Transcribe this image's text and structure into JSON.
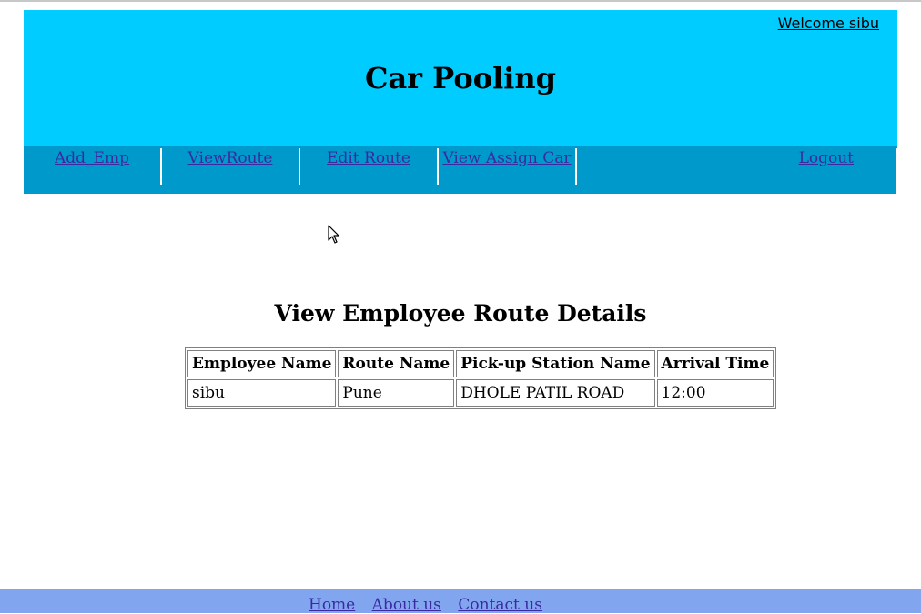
{
  "header": {
    "welcome": "Welcome sibu",
    "title": "Car Pooling",
    "background": "#00ccff"
  },
  "nav": {
    "items": [
      {
        "label": "Add_Emp"
      },
      {
        "label": "ViewRoute"
      },
      {
        "label": "Edit Route"
      },
      {
        "label": "View Assign Car"
      },
      {
        "label": "Logout"
      }
    ],
    "background": "#0099cc"
  },
  "main": {
    "title": "View Employee Route Details",
    "table": {
      "headers": [
        "Employee Name",
        "Route Name",
        "Pick-up Station Name",
        "Arrival Time"
      ],
      "rows": [
        [
          "sibu",
          "Pune",
          "DHOLE PATIL ROAD",
          "12:00"
        ]
      ]
    }
  },
  "footer": {
    "links": [
      "Home",
      "About us",
      "Contact us"
    ],
    "background": "#82a5f0"
  },
  "icons": {
    "cursor": "mouse-pointer-icon"
  }
}
